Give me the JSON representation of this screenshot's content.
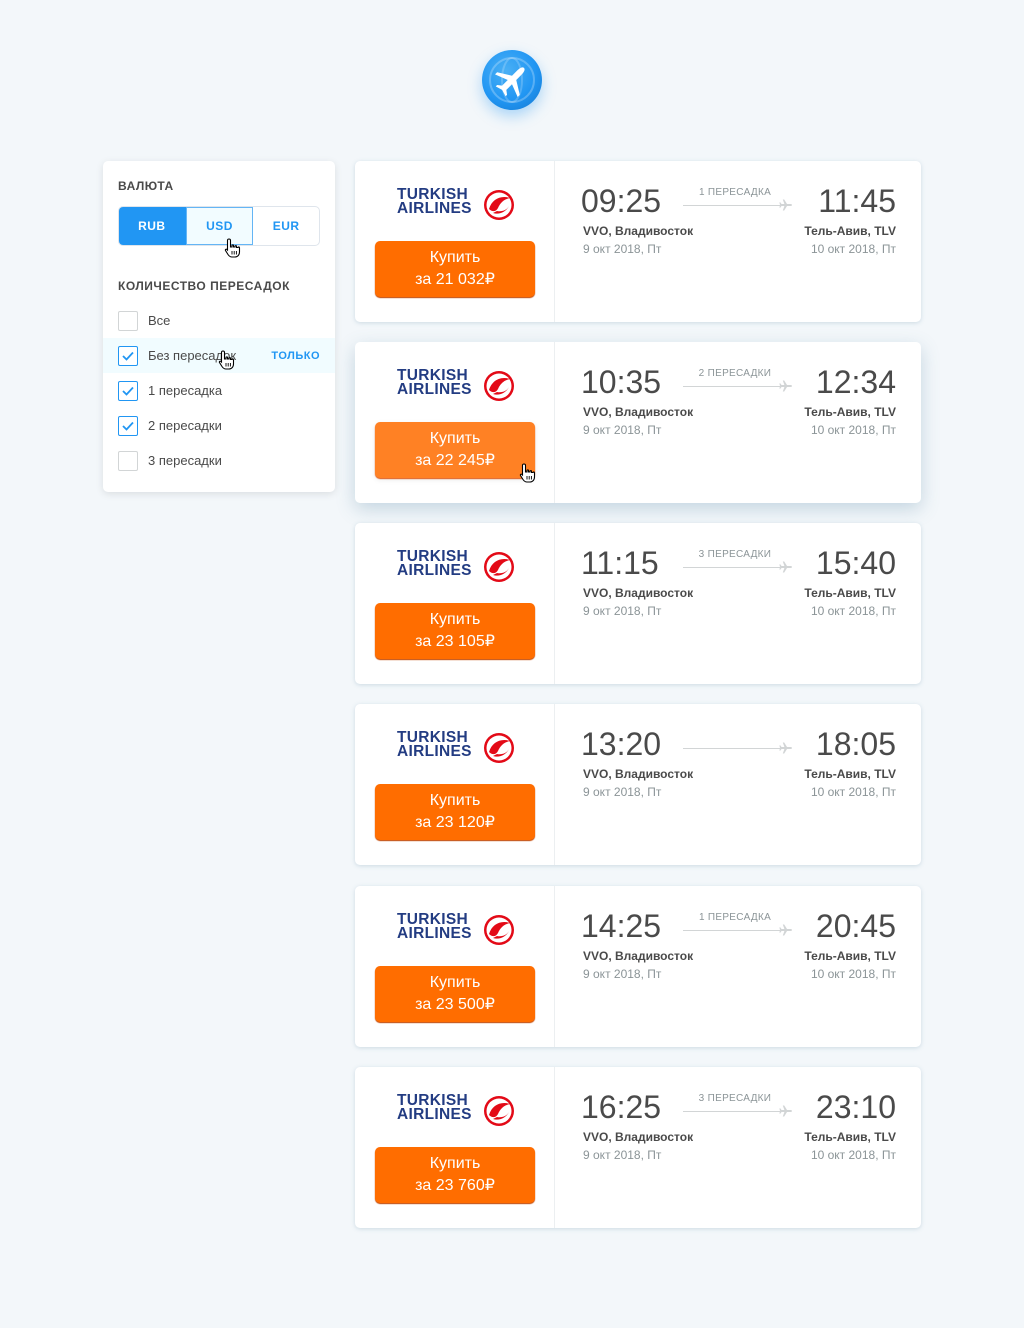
{
  "icons": {
    "logo": "airplane-icon",
    "route": "plane-icon",
    "check": "check-icon",
    "cursor": "hand-pointer-icon"
  },
  "colors": {
    "accent": "#2196f3",
    "buy_button": "#ff6d00",
    "brand_navy": "#233c82",
    "brand_red": "#e30a17"
  },
  "filters": {
    "currency_title": "Валюта",
    "currencies": [
      {
        "label": "RUB",
        "selected": true
      },
      {
        "label": "USD",
        "selected": false
      },
      {
        "label": "EUR",
        "selected": false
      }
    ],
    "stops_title": "Количество пересадок",
    "stops": [
      {
        "label": "Все",
        "checked": false
      },
      {
        "label": "Без пересадок",
        "checked": true,
        "only_label": "только"
      },
      {
        "label": "1 пересадка",
        "checked": true
      },
      {
        "label": "2 пересадки",
        "checked": true
      },
      {
        "label": "3 пересадки",
        "checked": false
      }
    ]
  },
  "tickets": [
    {
      "airline": "TURKISH AIRLINES",
      "buy": "Купить",
      "price": "за 21 032₽",
      "dep_time": "09:25",
      "arr_time": "11:45",
      "stops": "1 пересадка",
      "dep_city": "VVO, Владивосток",
      "arr_city": "Тель-Авив, TLV",
      "dep_date": "9 окт 2018, Пт",
      "arr_date": "10 окт 2018, Пт"
    },
    {
      "airline": "TURKISH AIRLINES",
      "buy": "Купить",
      "price": "за 22 245₽",
      "dep_time": "10:35",
      "arr_time": "12:34",
      "stops": "2 пересадки",
      "dep_city": "VVO, Владивосток",
      "arr_city": "Тель-Авив, TLV",
      "dep_date": "9 окт 2018, Пт",
      "arr_date": "10 окт 2018, Пт"
    },
    {
      "airline": "TURKISH AIRLINES",
      "buy": "Купить",
      "price": "за 23 105₽",
      "dep_time": "11:15",
      "arr_time": "15:40",
      "stops": "3 пересадки",
      "dep_city": "VVO, Владивосток",
      "arr_city": "Тель-Авив, TLV",
      "dep_date": "9 окт 2018, Пт",
      "arr_date": "10 окт 2018, Пт"
    },
    {
      "airline": "TURKISH AIRLINES",
      "buy": "Купить",
      "price": "за 23 120₽",
      "dep_time": "13:20",
      "arr_time": "18:05",
      "stops": "",
      "dep_city": "VVO, Владивосток",
      "arr_city": "Тель-Авив, TLV",
      "dep_date": "9 окт 2018, Пт",
      "arr_date": "10 окт 2018, Пт"
    },
    {
      "airline": "TURKISH AIRLINES",
      "buy": "Купить",
      "price": "за 23 500₽",
      "dep_time": "14:25",
      "arr_time": "20:45",
      "stops": "1 пересадка",
      "dep_city": "VVO, Владивосток",
      "arr_city": "Тель-Авив, TLV",
      "dep_date": "9 окт 2018, Пт",
      "arr_date": "10 окт 2018, Пт"
    },
    {
      "airline": "TURKISH AIRLINES",
      "buy": "Купить",
      "price": "за 23 760₽",
      "dep_time": "16:25",
      "arr_time": "23:10",
      "stops": "3 пересадки",
      "dep_city": "VVO, Владивосток",
      "arr_city": "Тель-Авив, TLV",
      "dep_date": "9 окт 2018, Пт",
      "arr_date": "10 окт 2018, Пт"
    }
  ]
}
